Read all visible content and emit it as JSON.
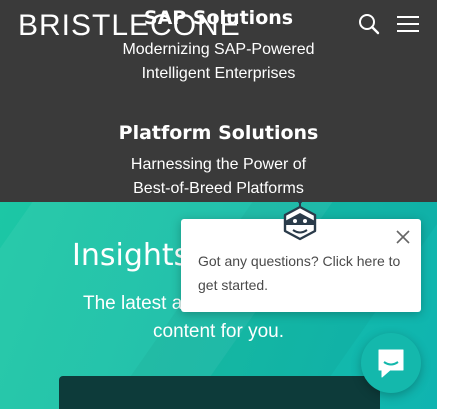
{
  "header": {
    "logo_text": "BRISTLECONE",
    "icons": [
      "search-icon",
      "hamburger-menu-icon"
    ]
  },
  "solutions": [
    {
      "title": "SAP Solutions",
      "description_lines": [
        "Modernizing SAP-Powered",
        "Intelligent Enterprises"
      ]
    },
    {
      "title": "Platform Solutions",
      "description_lines": [
        "Harnessing the Power of",
        "Best-of-Breed Platforms"
      ]
    }
  ],
  "insights": {
    "title": "Insights",
    "subtitle_lines": [
      "The latest a",
      "content for you."
    ]
  },
  "chat": {
    "message": "Got any questions? Click here to get started.",
    "icons": [
      "bot-icon",
      "close-icon",
      "chat-bubble-icon"
    ]
  },
  "colors": {
    "dark_bg": "#3a3a3a",
    "teal": "#1cc7a5",
    "launcher": "#14b8ac",
    "dark_box": "#0d3b3a"
  }
}
